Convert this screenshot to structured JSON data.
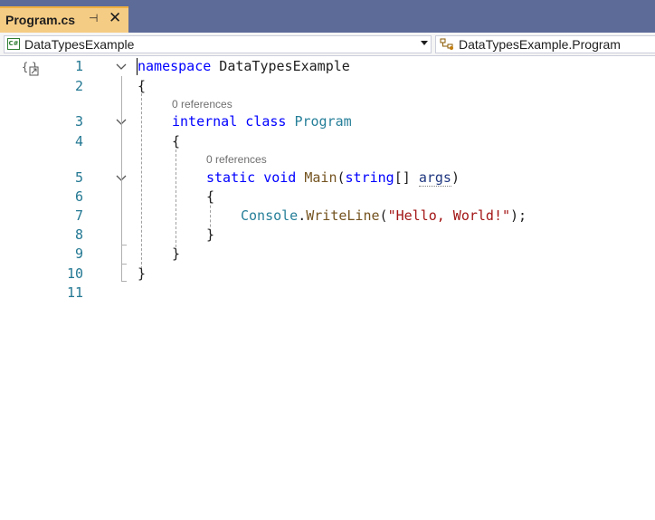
{
  "tab": {
    "title": "Program.cs",
    "pin_glyph": "⊣",
    "close_glyph": "✕"
  },
  "navbar": {
    "project": "DataTypesExample",
    "cs_badge": "C#",
    "member": "DataTypesExample.Program"
  },
  "editor": {
    "line_numbers": [
      "1",
      "2",
      "3",
      "4",
      "5",
      "6",
      "7",
      "8",
      "9",
      "10",
      "11"
    ],
    "codelens": [
      "0 references",
      "0 references"
    ],
    "code": {
      "l1_kw": "namespace",
      "l1_name": " DataTypesExample",
      "l2": "{",
      "l3_kw1": "internal",
      "l3_kw2": " class",
      "l3_name": " Program",
      "l4": "{",
      "l5_kw1": "static",
      "l5_kw2": " void",
      "l5_method": " Main",
      "l5_open": "(",
      "l5_type": "string",
      "l5_brackets": "[] ",
      "l5_param": "args",
      "l5_close": ")",
      "l6": "{",
      "l7_class": "Console",
      "l7_dot": ".",
      "l7_method": "WriteLine",
      "l7_open": "(",
      "l7_string": "\"Hello, World!\"",
      "l7_close": ");",
      "l8": "}",
      "l9": "}",
      "l10": "}"
    }
  }
}
